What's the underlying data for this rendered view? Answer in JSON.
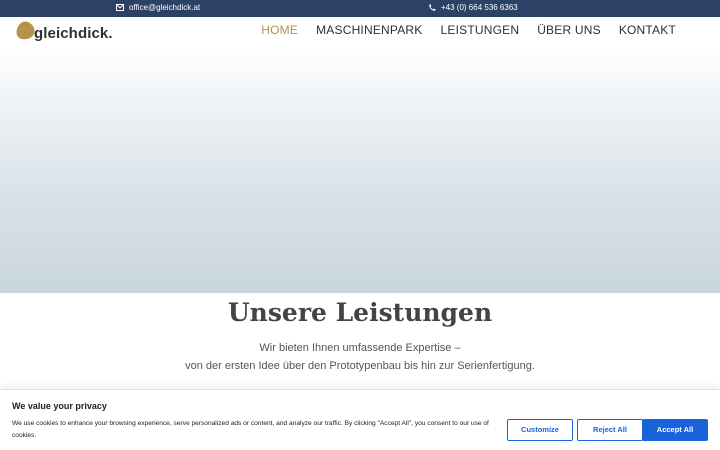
{
  "topbar": {
    "email": "office@gleichdick.at",
    "phone": "+43 (0) 664 536 6363",
    "email_icon": "envelope-icon",
    "phone_icon": "phone-icon"
  },
  "header": {
    "logo_text": "gleichdick.",
    "logo_color": "#b6914a",
    "nav": [
      {
        "label": "HOME",
        "active": true
      },
      {
        "label": "MASCHINENPARK",
        "active": false
      },
      {
        "label": "LEISTUNGEN",
        "active": false
      },
      {
        "label": "ÜBER UNS",
        "active": false
      },
      {
        "label": "KONTAKT",
        "active": false
      }
    ]
  },
  "section": {
    "title": "Unsere Leistungen",
    "subtitle_line1": "Wir bieten Ihnen umfassende Expertise –",
    "subtitle_line2": "von der ersten Idee über den Prototypenbau bis hin zur Serienfertigung."
  },
  "cookie": {
    "title": "We value your privacy",
    "text": "We use cookies to enhance your browsing experience, serve personalized ads or content, and analyze our traffic. By clicking \"Accept All\", you consent to our use of cookies.",
    "customize_label": "Customize",
    "reject_label": "Reject All",
    "accept_label": "Accept All",
    "accent_color": "#1863dc"
  },
  "colors": {
    "topbar_bg": "#2b4266",
    "nav_active": "#b6914a"
  }
}
